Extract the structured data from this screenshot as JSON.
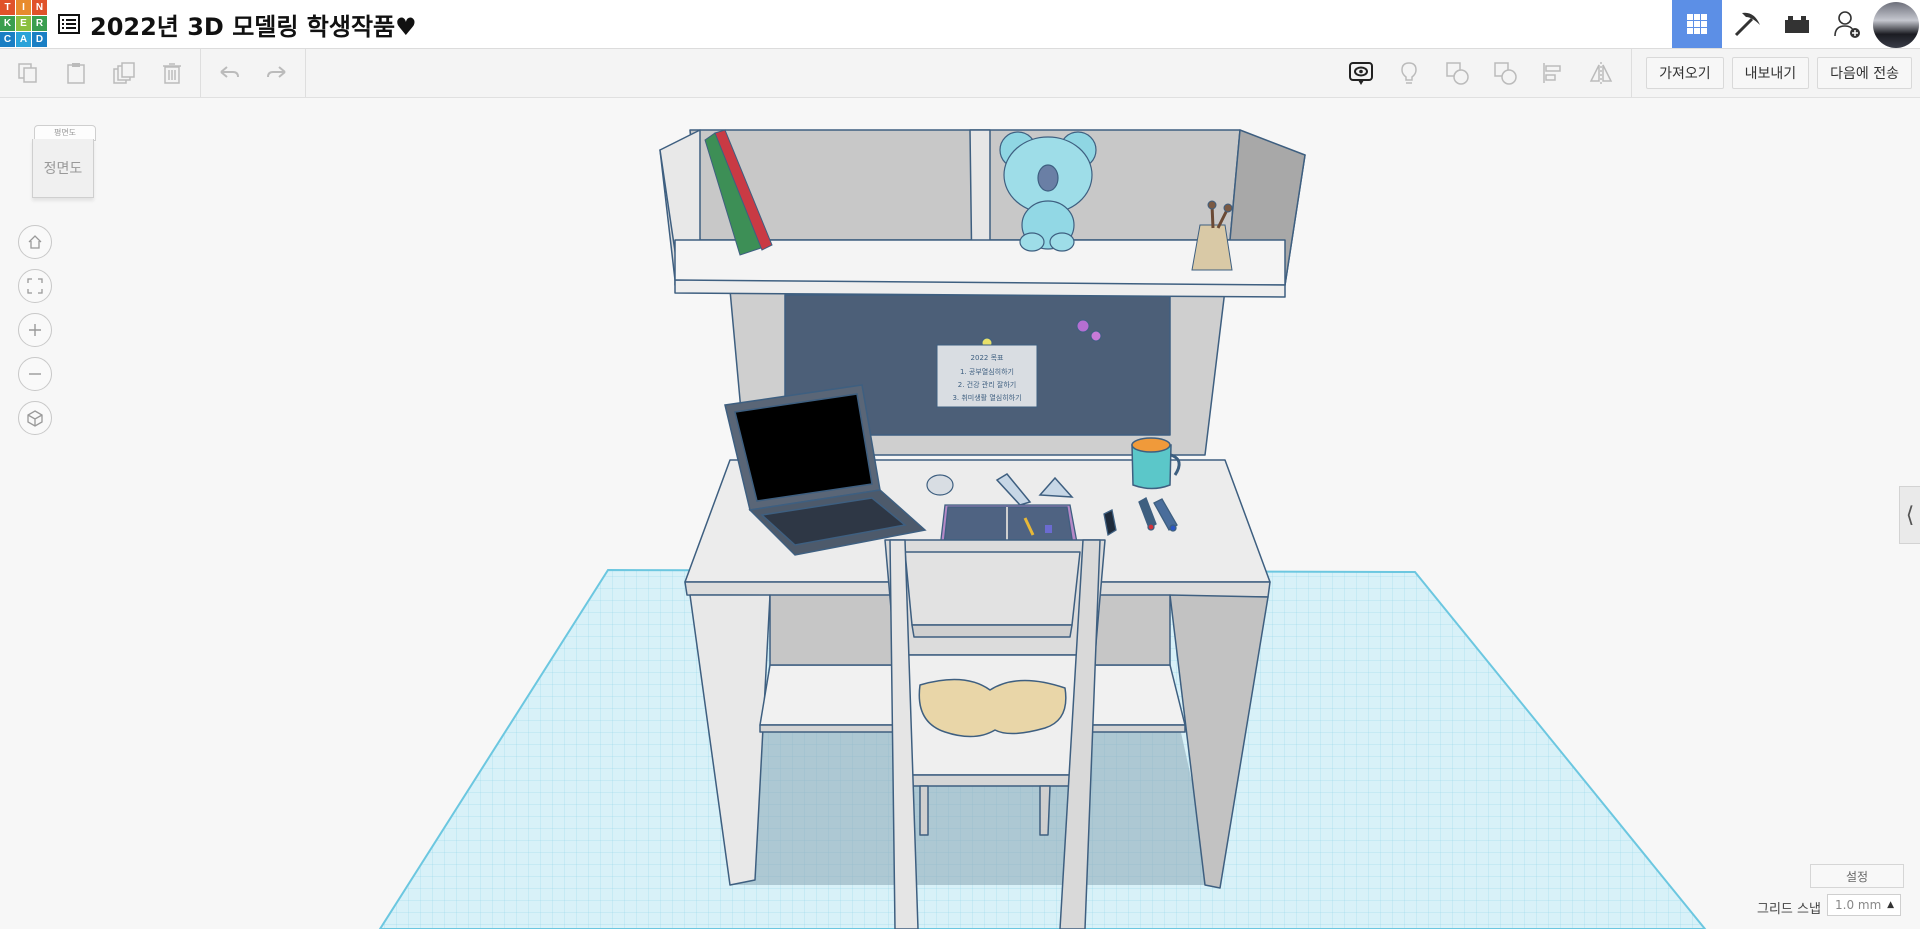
{
  "app": {
    "logo_letters": [
      "T",
      "I",
      "N",
      "K",
      "E",
      "R",
      "C",
      "A",
      "D"
    ],
    "title": "2022년 3D 모델링 학생작품♥"
  },
  "top_right": {
    "buttons": [
      "grid-view-icon",
      "pickaxe-icon",
      "bricks-icon",
      "add-user-icon"
    ]
  },
  "toolbar": {
    "left_buttons": [
      "copy-icon",
      "paste-icon",
      "duplicate-icon",
      "delete-icon",
      "undo-icon",
      "redo-icon"
    ],
    "right_icons": [
      "notes-icon",
      "lightbulb-icon",
      "group-icon",
      "ungroup-icon",
      "align-icon",
      "mirror-icon"
    ],
    "import_label": "가져오기",
    "export_label": "내보내기",
    "send_label": "다음에 전송"
  },
  "viewcube": {
    "top_label": "평면도",
    "front_label": "정면도"
  },
  "nav": [
    "home-icon",
    "fit-view-icon",
    "zoom-in-icon",
    "zoom-out-icon",
    "perspective-icon"
  ],
  "scene": {
    "note_lines": [
      "2022 목표",
      "1. 공부열심히하기",
      "2. 건강 관리 잘하기",
      "3. 취미생활 열심히하기"
    ]
  },
  "bottom": {
    "settings_label": "설정",
    "snap_label": "그리드 스냅",
    "snap_value": "1.0 mm",
    "snap_arrow": "▲"
  },
  "colors": {
    "accent": "#5c8fe6",
    "grid": "#7fd0e6",
    "outline": "#3e5f80"
  }
}
